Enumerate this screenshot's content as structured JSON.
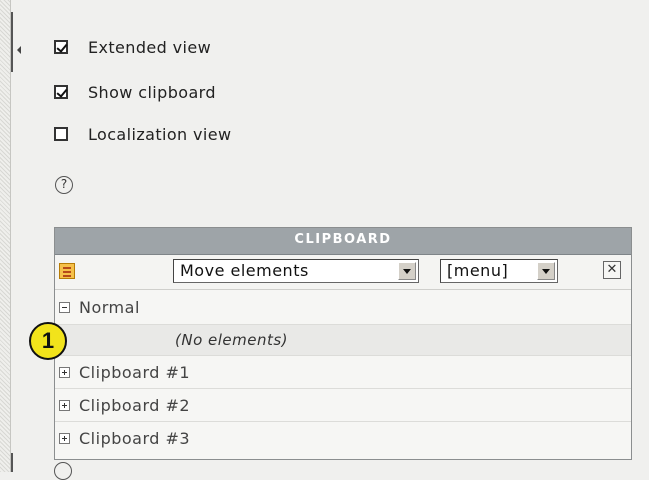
{
  "options": [
    {
      "label": "Extended view",
      "checked": true
    },
    {
      "label": "Show clipboard",
      "checked": true
    },
    {
      "label": "Localization view",
      "checked": false
    }
  ],
  "help_icon": "?",
  "clipboard": {
    "title": "CLIPBOARD",
    "mode_select": "Move elements",
    "menu_select": "[menu]",
    "close_symbol": "✕",
    "normal_label": "Normal",
    "empty_text": "(No elements)",
    "pads": [
      "Clipboard #1",
      "Clipboard #2",
      "Clipboard #3"
    ]
  },
  "annotation_badge": "1"
}
